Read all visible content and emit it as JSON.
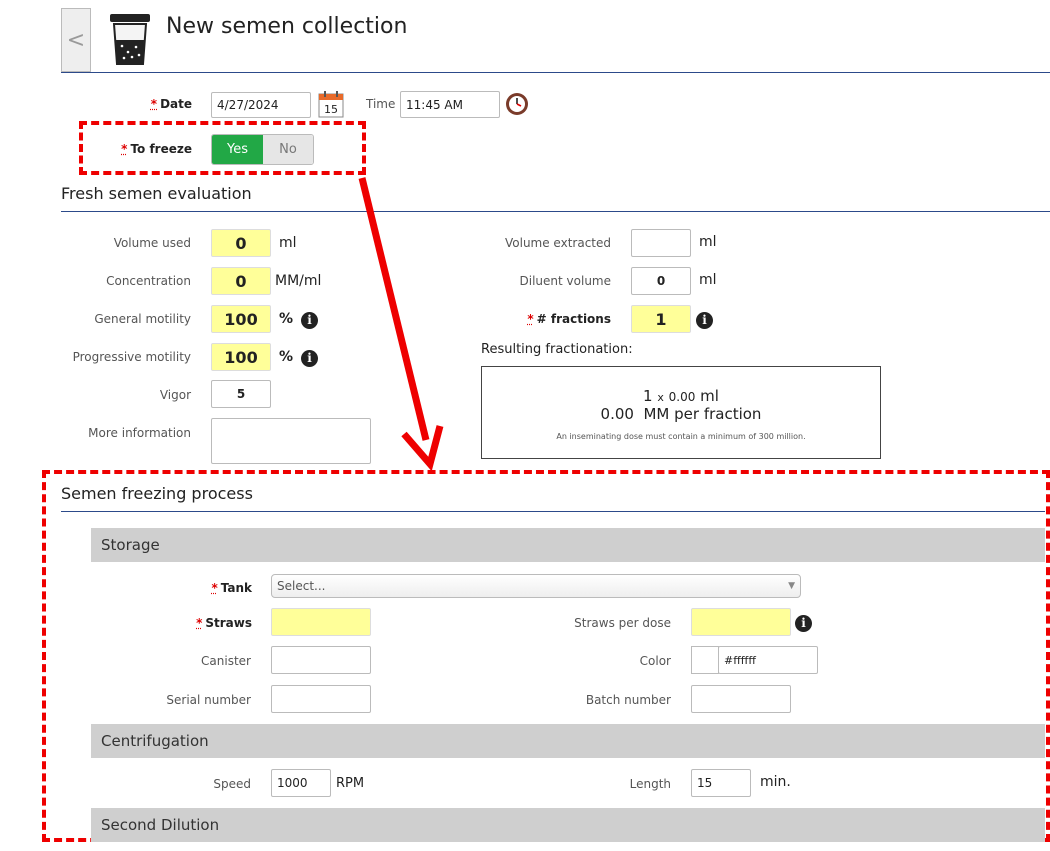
{
  "header": {
    "back_glyph": "<",
    "title": "New semen collection"
  },
  "basics": {
    "date_label": "Date",
    "date_value": "4/27/2024",
    "calendar_day": "15",
    "time_label": "Time",
    "time_value": "11:45 AM",
    "freeze_label": "To freeze",
    "yes_label": "Yes",
    "no_label": "No",
    "freeze_selected": "Yes",
    "required_mark": "*"
  },
  "fresh": {
    "title": "Fresh semen evaluation",
    "volume_used_label": "Volume used",
    "volume_used_value": "0",
    "volume_used_unit": "ml",
    "concentration_label": "Concentration",
    "concentration_value": "0",
    "concentration_unit": "MM/ml",
    "general_motility_label": "General motility",
    "general_motility_value": "100",
    "general_motility_unit": "%",
    "progressive_motility_label": "Progressive motility",
    "progressive_motility_value": "100",
    "progressive_motility_unit": "%",
    "vigor_label": "Vigor",
    "vigor_value": "5",
    "more_info_label": "More information",
    "volume_extracted_label": "Volume extracted",
    "volume_extracted_unit": "ml",
    "diluent_volume_label": "Diluent volume",
    "diluent_volume_value": "0",
    "diluent_volume_unit": "ml",
    "fractions_label": "# fractions",
    "fractions_value": "1",
    "result_label": "Resulting fractionation:",
    "result_count": "1",
    "result_x": "x",
    "result_vol": "0.00",
    "result_unit": "ml",
    "result_mm": "0.00  MM per fraction",
    "result_note": "An inseminating dose must contain a minimum of 300 million."
  },
  "freezing": {
    "title": "Semen freezing process",
    "storage_title": "Storage",
    "tank_label": "Tank",
    "tank_placeholder": "Select...",
    "straws_label": "Straws",
    "straws_per_dose_label": "Straws per dose",
    "canister_label": "Canister",
    "color_label": "Color",
    "color_value": "#ffffff",
    "serial_label": "Serial number",
    "batch_label": "Batch number",
    "centrifugation_title": "Centrifugation",
    "speed_label": "Speed",
    "speed_value": "1000",
    "speed_unit": "RPM",
    "length_label": "Length",
    "length_value": "15",
    "length_unit": "min.",
    "second_dilution_title": "Second Dilution"
  },
  "icons": {
    "info": "i",
    "app": "specimen-cup-icon",
    "calendar": "calendar-icon",
    "clock": "clock-icon",
    "dropdown": "chevron-down-icon"
  },
  "colors": {
    "accent_green": "#22a846",
    "header_rule": "#2c4a8a",
    "highlight_yellow": "#ffff99",
    "annotation_red": "#e00000"
  }
}
